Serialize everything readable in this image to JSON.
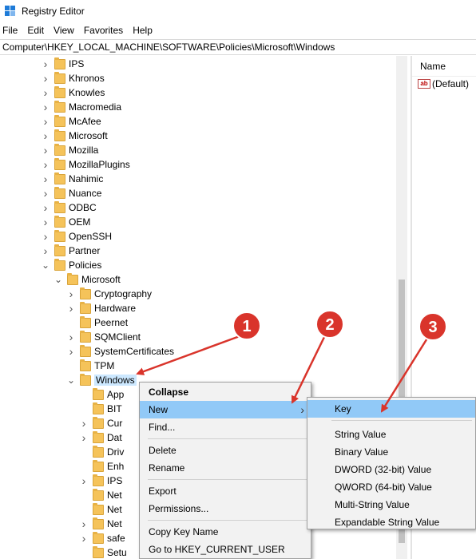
{
  "window": {
    "title": "Registry Editor"
  },
  "menubar": [
    "File",
    "Edit",
    "View",
    "Favorites",
    "Help"
  ],
  "address": "Computer\\HKEY_LOCAL_MACHINE\\SOFTWARE\\Policies\\Microsoft\\Windows",
  "tree": [
    {
      "label": "IPS",
      "level": 0,
      "chevron": "collapsed"
    },
    {
      "label": "Khronos",
      "level": 0,
      "chevron": "collapsed"
    },
    {
      "label": "Knowles",
      "level": 0,
      "chevron": "collapsed"
    },
    {
      "label": "Macromedia",
      "level": 0,
      "chevron": "collapsed"
    },
    {
      "label": "McAfee",
      "level": 0,
      "chevron": "collapsed"
    },
    {
      "label": "Microsoft",
      "level": 0,
      "chevron": "collapsed"
    },
    {
      "label": "Mozilla",
      "level": 0,
      "chevron": "collapsed"
    },
    {
      "label": "MozillaPlugins",
      "level": 0,
      "chevron": "collapsed"
    },
    {
      "label": "Nahimic",
      "level": 0,
      "chevron": "collapsed"
    },
    {
      "label": "Nuance",
      "level": 0,
      "chevron": "collapsed"
    },
    {
      "label": "ODBC",
      "level": 0,
      "chevron": "collapsed"
    },
    {
      "label": "OEM",
      "level": 0,
      "chevron": "collapsed"
    },
    {
      "label": "OpenSSH",
      "level": 0,
      "chevron": "collapsed"
    },
    {
      "label": "Partner",
      "level": 0,
      "chevron": "collapsed"
    },
    {
      "label": "Policies",
      "level": 0,
      "chevron": "expanded"
    },
    {
      "label": "Microsoft",
      "level": 1,
      "chevron": "expanded"
    },
    {
      "label": "Cryptography",
      "level": 2,
      "chevron": "collapsed"
    },
    {
      "label": "Hardware",
      "level": 2,
      "chevron": "collapsed"
    },
    {
      "label": "Peernet",
      "level": 2,
      "chevron": "none"
    },
    {
      "label": "SQMClient",
      "level": 2,
      "chevron": "collapsed"
    },
    {
      "label": "SystemCertificates",
      "level": 2,
      "chevron": "collapsed"
    },
    {
      "label": "TPM",
      "level": 2,
      "chevron": "none"
    },
    {
      "label": "Windows",
      "level": 2,
      "chevron": "expanded",
      "selected": true
    },
    {
      "label": "App",
      "level": 3,
      "chevron": "none"
    },
    {
      "label": "BIT",
      "level": 3,
      "chevron": "none"
    },
    {
      "label": "Cur",
      "level": 3,
      "chevron": "collapsed"
    },
    {
      "label": "Dat",
      "level": 3,
      "chevron": "collapsed"
    },
    {
      "label": "Driv",
      "level": 3,
      "chevron": "none"
    },
    {
      "label": "Enh",
      "level": 3,
      "chevron": "none"
    },
    {
      "label": "IPS",
      "level": 3,
      "chevron": "collapsed"
    },
    {
      "label": "Net",
      "level": 3,
      "chevron": "none"
    },
    {
      "label": "Net",
      "level": 3,
      "chevron": "none"
    },
    {
      "label": "Net",
      "level": 3,
      "chevron": "collapsed"
    },
    {
      "label": "safe",
      "level": 3,
      "chevron": "collapsed"
    },
    {
      "label": "Setu",
      "level": 3,
      "chevron": "none"
    }
  ],
  "right_pane": {
    "column_header": "Name",
    "values": [
      {
        "name": "(Default)"
      }
    ]
  },
  "context_menu": {
    "items": [
      {
        "label": "Collapse",
        "bold": true
      },
      {
        "label": "New",
        "submenu": true,
        "highlighted": true
      },
      {
        "label": "Find..."
      },
      {
        "separator": true
      },
      {
        "label": "Delete"
      },
      {
        "label": "Rename"
      },
      {
        "separator": true
      },
      {
        "label": "Export"
      },
      {
        "label": "Permissions..."
      },
      {
        "separator": true
      },
      {
        "label": "Copy Key Name"
      },
      {
        "label": "Go to HKEY_CURRENT_USER"
      }
    ]
  },
  "submenu_new": {
    "items": [
      {
        "label": "Key",
        "highlighted": true
      },
      {
        "separator": true
      },
      {
        "label": "String Value"
      },
      {
        "label": "Binary Value"
      },
      {
        "label": "DWORD (32-bit) Value"
      },
      {
        "label": "QWORD (64-bit) Value"
      },
      {
        "label": "Multi-String Value"
      },
      {
        "label": "Expandable String Value"
      }
    ]
  },
  "annotations": [
    {
      "number": "1"
    },
    {
      "number": "2"
    },
    {
      "number": "3"
    }
  ],
  "colors": {
    "highlight": "#91c9f7",
    "selection": "#cce8ff",
    "folder": "#f5c35a",
    "annotation_red": "#d9342b"
  }
}
